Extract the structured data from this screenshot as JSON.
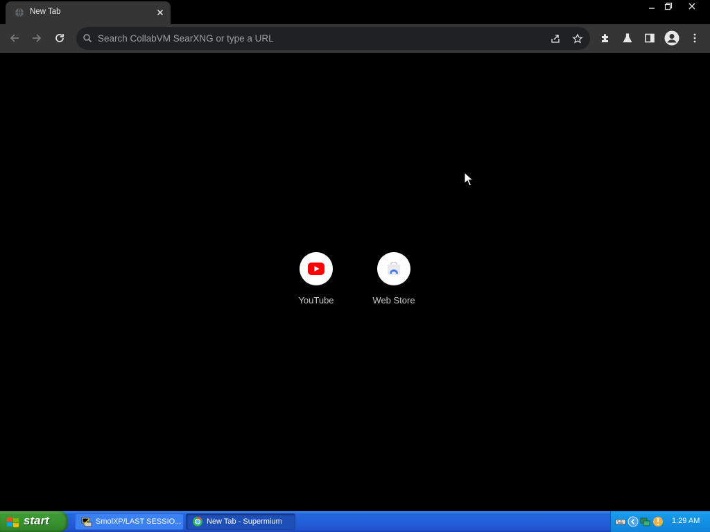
{
  "browser": {
    "tab": {
      "title": "New Tab",
      "favicon": "globe-icon"
    },
    "omnibox": {
      "placeholder": "Search CollabVM SearXNG or type a URL"
    },
    "toolbar_icons": [
      "back-arrow-icon",
      "forward-arrow-icon",
      "reload-icon",
      "share-icon",
      "star-icon",
      "puzzle-icon",
      "flask-icon",
      "side-panel-icon",
      "profile-icon",
      "more-menu-icon"
    ]
  },
  "newtab": {
    "shortcuts": [
      {
        "label": "YouTube",
        "icon": "youtube-icon"
      },
      {
        "label": "Web Store",
        "icon": "webstore-icon"
      }
    ]
  },
  "taskbar": {
    "start_label": "start",
    "tasks": [
      {
        "label": "SmolXP/LAST SESSIO...",
        "icon": "putty-icon",
        "active": false
      },
      {
        "label": "New Tab - Supermium",
        "icon": "browser-icon",
        "active": true
      }
    ],
    "clock": "1:29 AM"
  },
  "colors": {
    "chrome_bg": "#353535",
    "omnibox_bg": "#202124",
    "page_bg": "#000000",
    "taskbar_blue": "#245edb",
    "start_green": "#379030",
    "youtube_red": "#ff0000"
  }
}
